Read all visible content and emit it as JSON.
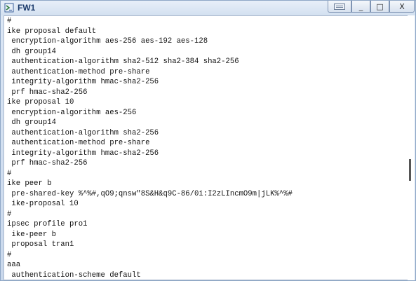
{
  "window": {
    "title": "FW1",
    "buttons": {
      "extra": "",
      "minimize": "_",
      "maximize": "□",
      "close": "X"
    }
  },
  "icons": {
    "app": "terminal-app-icon",
    "extra": "keyboard-icon"
  },
  "console_lines": [
    "#",
    "ike proposal default",
    " encryption-algorithm aes-256 aes-192 aes-128",
    " dh group14",
    " authentication-algorithm sha2-512 sha2-384 sha2-256",
    " authentication-method pre-share",
    " integrity-algorithm hmac-sha2-256",
    " prf hmac-sha2-256",
    "ike proposal 10",
    " encryption-algorithm aes-256",
    " dh group14",
    " authentication-algorithm sha2-256",
    " authentication-method pre-share",
    " integrity-algorithm hmac-sha2-256",
    " prf hmac-sha2-256",
    "#",
    "ike peer b",
    " pre-shared-key %^%#,qO9;qnsw\"8S&H&q9C-86/0i:I2zLIncmO9m|jLK%^%#",
    " ike-proposal 10",
    "#",
    "ipsec profile pro1",
    " ike-peer b",
    " proposal tran1",
    "#",
    "aaa",
    " authentication-scheme default"
  ],
  "colors": {
    "title_text": "#1a3a6b",
    "console_bg": "#ffffff",
    "console_text": "#111111"
  }
}
